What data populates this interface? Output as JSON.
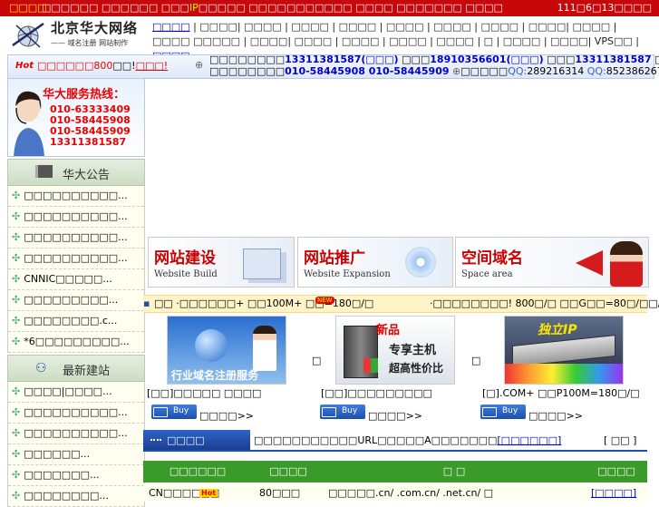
{
  "topbar": {
    "hot": "□□□□",
    "text_a": "□□□□□□ □□□□□□ □□□",
    "ip": "IP",
    "text_b": "□□□□□ □□□□□□□□□□□ □□□□ □□□□□□□ □□□□",
    "date": "111□6□13□□□□"
  },
  "logo": {
    "title": "北京华大网络",
    "subtitle": "—— 域名注册 网站制作"
  },
  "nav": {
    "items": [
      "□□□□",
      "□□□□| □□□□",
      "□□□□ | □□□□",
      "□□□□",
      "□□□□",
      "□□□□",
      "□□□□| □□□□",
      "□□□□ □□□□□",
      "□□□□| □□□□",
      "□□□□",
      "□□□□",
      "□□□□",
      "□ | □□□□",
      "□□□□| VPS□□",
      "□□□□"
    ]
  },
  "strip": {
    "hot": "Hot",
    "promo_a": "□□□□□□800",
    "promo_b": "□□!",
    "promo_link": "□□□!",
    "line1_a": "□□□□□□□□",
    "line1_tel1": "13311381587(□□□)",
    "line1_b": " □□□",
    "line1_tel2": "18910356601(□□□)",
    "line1_c": " □□□",
    "line1_tel3": "13311381587",
    "line1_d": " □",
    "line2_a": "□□□□□□□□",
    "line2_tel": "010-58445908 010-58445909",
    "line2_b": "□□□□□",
    "qq1_label": "QQ:",
    "qq1": "289216314",
    "qq2_label": " QQ:",
    "qq2": "852386267"
  },
  "hotline": {
    "title": "华大服务热线：",
    "numbers": [
      "010-63333409",
      "010-58445908",
      "010-58445909",
      "13311381587"
    ]
  },
  "notice": {
    "title": "华大公告",
    "items": [
      "□□□□□□□□□□...",
      "□□□□□□□□□□...",
      "□□□□□□□□□□...",
      "□□□□□□□□□□...",
      "CNNIC□□□□□...",
      "□□□□□□□□□...",
      "□□□□□□□□.c...",
      "*6□□□□□□□□□..."
    ]
  },
  "newsite": {
    "title": "最新建站",
    "items": [
      "□□□□|□□□□...",
      "□□□□□□□□□□...",
      "□□□□□□□□□□...",
      "□□□□□□...",
      "□□□□□□□...",
      "□□□□□□□□..."
    ]
  },
  "banners": [
    {
      "cn": "网站建设",
      "en": "Website Build"
    },
    {
      "cn": "网站推广",
      "en": "Website Expansion"
    },
    {
      "cn": "空间域名",
      "en": "Space area"
    }
  ],
  "ticker": {
    "left": "□□ ·□□□□□□+ □□100M+ □□=180□/□",
    "right": "·□□□□□□□□! 800□/□ □□G□□=80□/□□/□"
  },
  "products": [
    {
      "caption": "[□□]□□□□□ □□□□",
      "promo": "行业域名注册服务"
    },
    {
      "caption": "[□□]□□□□□□□□□",
      "promo_a": "新品",
      "promo_b": "专享主机",
      "promo_c": "超高性价比"
    },
    {
      "caption": "[□].COM+ □□P100M=180□/□",
      "promo": "独立IP"
    }
  ],
  "buy": {
    "label": "Buy",
    "more": "□□□□>>"
  },
  "domains": {
    "tab": "□□□□",
    "note": "□□□□□□□□□□□URL□□□□□A□□□□□□□",
    "note_link": "[□□□□□□]",
    "more": "[ □□ ]",
    "headers": [
      "□□□□□□",
      "□□□□",
      "□ □",
      "□□□□"
    ],
    "row": {
      "name": "CN□□□□□□",
      "hot": "Hot",
      "price": "80□□□",
      "desc": "□□□□□.cn/ .com.cn/ .net.cn/ □",
      "action": "[□□□□]"
    }
  },
  "colors": {
    "red": "#c8070b",
    "blue_link": "#0000cc",
    "green_head": "#3a9a2a",
    "navy_tab": "#1d4faf"
  }
}
